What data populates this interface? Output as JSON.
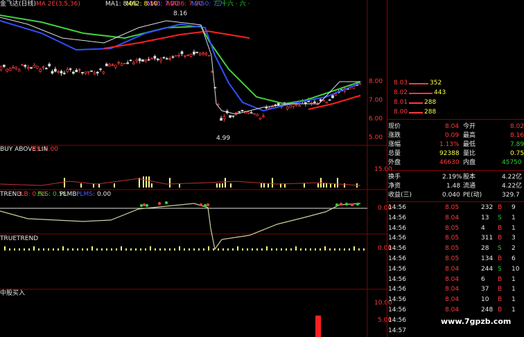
{
  "colors": {
    "up": "#ff3b3b",
    "down": "#30d030",
    "ma1": "#e8e8e8",
    "ma2": "#ffd700",
    "ma3": "#ff40ff",
    "ma36": "#ff4040",
    "ma50": "#4060ff"
  },
  "main": {
    "title": "金飞达(日线)",
    "ma_label": "MA 2E(3,5,36)",
    "ma1": "MA1: 8.05",
    "ma2": "MA2: 8.10",
    "ma3": "MA3: 7.20",
    "ma36": "MA36: 7.20",
    "ma50": "MA50: 7.7",
    "extra": "三十六 · 六 ·",
    "high_label": "8.16",
    "low_label": "4.99",
    "y_ticks": [
      "8.00",
      "7.00",
      "6.00",
      "5.00"
    ]
  },
  "ind1": {
    "title": "BUY ABOVE LIN",
    "title2": "RS: 0.00",
    "y_tick": "15.00"
  },
  "ind2": {
    "title": "TREND",
    "plb": "PLB: 0.58",
    "pls": "PLS: 0.58",
    "plmb": "PLMB:",
    "plms": "PLMS:",
    "val": "0.00",
    "y_tick": "0.00"
  },
  "ind3": {
    "title": "TRUETREND",
    "y_tick": "0.00"
  },
  "ind4": {
    "title": "中股买入",
    "y_ticks": [
      "10.00",
      "5.00"
    ]
  },
  "orderbook": [
    {
      "price": "8.03",
      "vol": "352"
    },
    {
      "price": "8.02",
      "vol": "443"
    },
    {
      "price": "8.01",
      "vol": "288"
    },
    {
      "price": "8.00",
      "vol": "288"
    }
  ],
  "quote": [
    {
      "l": "现价",
      "v": "8.04",
      "l2": "今开",
      "v2": "8.02"
    },
    {
      "l": "涨跌",
      "v": "0.09",
      "l2": "最高",
      "v2": "8.16"
    },
    {
      "l": "涨幅",
      "v": "1.13%",
      "l2": "最低",
      "v2": "7.89"
    },
    {
      "l": "总量",
      "v": "92388",
      "l2": "量比",
      "v2": "0.75"
    },
    {
      "l": "外盘",
      "v": "46630",
      "l2": "内盘",
      "v2": "45750"
    }
  ],
  "quote2": [
    {
      "l": "换手",
      "v": "2.19%",
      "l2": "股本",
      "v2": "4.22亿"
    },
    {
      "l": "净资",
      "v": "1.48",
      "l2": "流通",
      "v2": "4.22亿"
    },
    {
      "l": "收益(三)",
      "v": "0.040",
      "l2": "PE(动)",
      "v2": "329.7"
    }
  ],
  "trades": [
    {
      "time": "14:56",
      "price": "8.05",
      "vol": "232",
      "side": "B",
      "n": "9"
    },
    {
      "time": "14:56",
      "price": "8.04",
      "vol": "13",
      "side": "S",
      "n": "1"
    },
    {
      "time": "14:56",
      "price": "8.05",
      "vol": "4",
      "side": "B",
      "n": "1"
    },
    {
      "time": "14:56",
      "price": "8.05",
      "vol": "311",
      "side": "B",
      "n": "3"
    },
    {
      "time": "14:56",
      "price": "8.05",
      "vol": "28",
      "side": "S",
      "n": "2"
    },
    {
      "time": "14:56",
      "price": "8.05",
      "vol": "134",
      "side": "B",
      "n": "6"
    },
    {
      "time": "14:56",
      "price": "8.04",
      "vol": "244",
      "side": "S",
      "n": "10"
    },
    {
      "time": "14:56",
      "price": "8.04",
      "vol": "6",
      "side": "B",
      "n": "1"
    },
    {
      "time": "14:56",
      "price": "8.04",
      "vol": "37",
      "side": "B",
      "n": "1"
    },
    {
      "time": "14:56",
      "price": "8.04",
      "vol": "10",
      "side": "B",
      "n": "1"
    },
    {
      "time": "14:56",
      "price": "8.04",
      "vol": "248",
      "side": "B",
      "n": "1"
    },
    {
      "time": "14:56",
      "price": "",
      "vol": "",
      "side": "",
      "n": ""
    },
    {
      "time": "14:57",
      "price": "",
      "vol": "",
      "side": "",
      "n": ""
    }
  ],
  "watermark": "www.7gpzb.com"
}
